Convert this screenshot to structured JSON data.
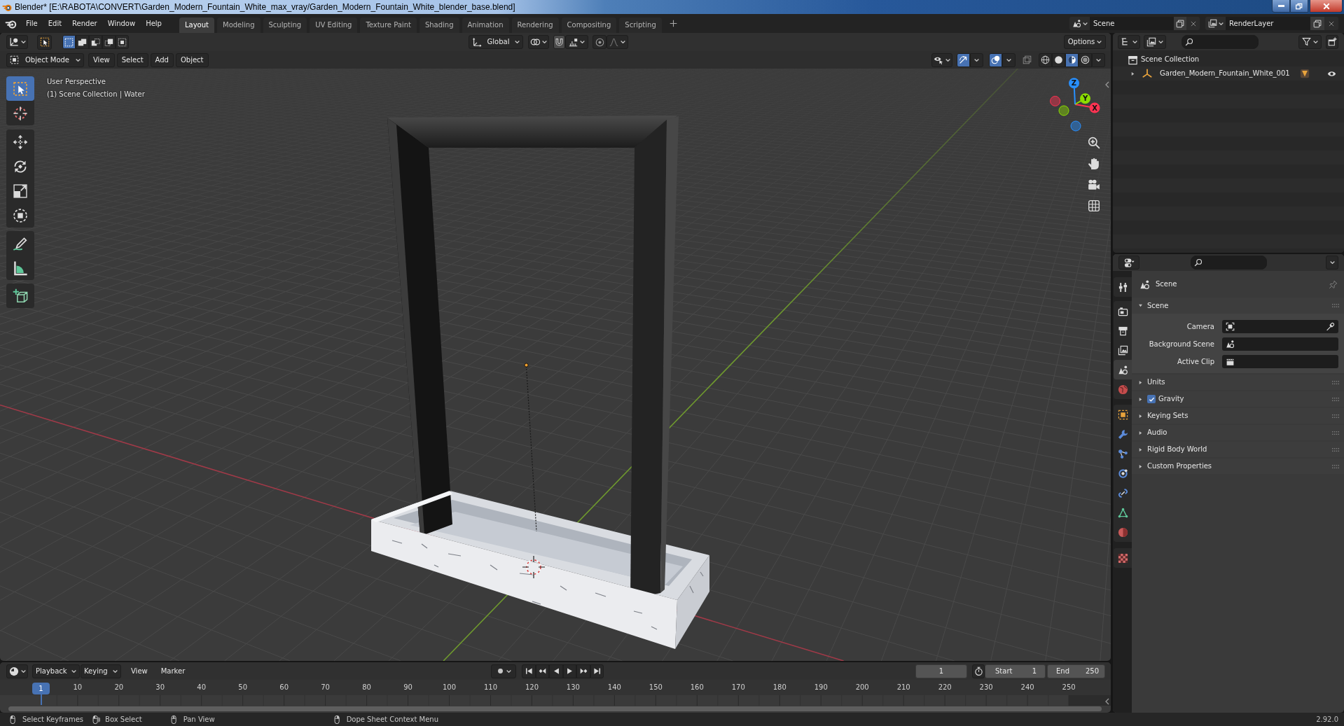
{
  "title_bar": {
    "title": "Blender* [E:\\RABOTA\\CONVERT\\Garden_Modern_Fountain_White_max_vray/Garden_Modern_Fountain_White_blender_base.blend]"
  },
  "top_bar": {
    "menus": [
      "File",
      "Edit",
      "Render",
      "Window",
      "Help"
    ],
    "workspaces": [
      {
        "label": "Layout",
        "selected": true
      },
      {
        "label": "Modeling",
        "selected": false
      },
      {
        "label": "Sculpting",
        "selected": false
      },
      {
        "label": "UV Editing",
        "selected": false
      },
      {
        "label": "Texture Paint",
        "selected": false
      },
      {
        "label": "Shading",
        "selected": false
      },
      {
        "label": "Animation",
        "selected": false
      },
      {
        "label": "Rendering",
        "selected": false
      },
      {
        "label": "Compositing",
        "selected": false
      },
      {
        "label": "Scripting",
        "selected": false
      }
    ],
    "scene": "Scene",
    "view_layer": "RenderLayer"
  },
  "tool_header": {
    "select_modes": [
      {
        "kind": "set",
        "selected": true
      },
      {
        "kind": "extend",
        "selected": false
      },
      {
        "kind": "subtract",
        "selected": false
      },
      {
        "kind": "difference",
        "selected": false
      },
      {
        "kind": "intersect",
        "selected": false
      }
    ],
    "orientation": "Global",
    "snap_on": false,
    "proportional_on": false,
    "options": "Options"
  },
  "viewport_header": {
    "mode": "Object Mode",
    "menus": [
      "View",
      "Select",
      "Add",
      "Object"
    ],
    "gizmos_on": true,
    "overlays_on": true,
    "xray_on": false,
    "shading": [
      {
        "kind": "wireframe",
        "selected": false
      },
      {
        "kind": "solid",
        "selected": false
      },
      {
        "kind": "material",
        "selected": true
      },
      {
        "kind": "rendered",
        "selected": false
      }
    ]
  },
  "viewport": {
    "tools": [
      {
        "kind": "select_box",
        "selected": true
      },
      {
        "kind": "cursor",
        "selected": false
      },
      {
        "kind": "move",
        "selected": false
      },
      {
        "kind": "rotate",
        "selected": false
      },
      {
        "kind": "scale",
        "selected": false
      },
      {
        "kind": "transform",
        "selected": false
      },
      {
        "kind": "annotate",
        "selected": false
      },
      {
        "kind": "measure",
        "selected": false
      },
      {
        "kind": "add_cube",
        "selected": false
      }
    ],
    "view_name": "User Perspective",
    "collection_info": "(1) Scene Collection | Water",
    "axes": [
      {
        "label": "X",
        "color": "#ff3352"
      },
      {
        "label": "Y",
        "color": "#8bdc00"
      },
      {
        "label": "Z",
        "color": "#2890ff"
      }
    ]
  },
  "outliner": {
    "root": "Scene Collection",
    "items": [
      {
        "label": "Garden_Modern_Fountain_White_001",
        "expanded": false,
        "visible": true
      }
    ]
  },
  "properties": {
    "tabs": [
      {
        "kind": "tool",
        "selected": false
      },
      {
        "kind": "render",
        "selected": false
      },
      {
        "kind": "output",
        "selected": false
      },
      {
        "kind": "view_layer",
        "selected": false
      },
      {
        "kind": "scene",
        "selected": true
      },
      {
        "kind": "world",
        "selected": false
      },
      {
        "kind": "object",
        "selected": false
      },
      {
        "kind": "modifiers",
        "selected": false
      },
      {
        "kind": "particles",
        "selected": false
      },
      {
        "kind": "physics",
        "selected": false
      },
      {
        "kind": "constraints",
        "selected": false
      },
      {
        "kind": "data",
        "selected": false
      },
      {
        "kind": "material",
        "selected": false
      },
      {
        "kind": "texture",
        "selected": false
      }
    ],
    "context": "Scene",
    "panels": [
      {
        "label": "Scene",
        "kind": "section",
        "expanded": true,
        "fields": [
          {
            "label": "Camera",
            "kind": "camera"
          },
          {
            "label": "Background Scene",
            "kind": "scene"
          },
          {
            "label": "Active Clip",
            "kind": "clip"
          }
        ]
      },
      {
        "label": "Units",
        "kind": "section",
        "expanded": false
      },
      {
        "label": "Gravity",
        "kind": "checkbox",
        "checked": true,
        "expanded": false
      },
      {
        "label": "Keying Sets",
        "kind": "section",
        "expanded": false
      },
      {
        "label": "Audio",
        "kind": "section",
        "expanded": false
      },
      {
        "label": "Rigid Body World",
        "kind": "section",
        "expanded": false
      },
      {
        "label": "Custom Properties",
        "kind": "section",
        "expanded": false
      }
    ]
  },
  "timeline": {
    "menus": [
      {
        "label": "Playback",
        "kind": "dropdown"
      },
      {
        "label": "Keying",
        "kind": "dropdown"
      },
      {
        "label": "View",
        "kind": "menu"
      },
      {
        "label": "Marker",
        "kind": "menu"
      }
    ],
    "auto_keying_on": false,
    "current_frame": "1",
    "start_label": "Start",
    "start": "1",
    "end_label": "End",
    "end": "250",
    "playhead": "1",
    "ruler": [
      "10",
      "20",
      "30",
      "40",
      "50",
      "60",
      "70",
      "80",
      "90",
      "100",
      "110",
      "120",
      "130",
      "140",
      "150",
      "160",
      "170",
      "180",
      "190",
      "200",
      "210",
      "220",
      "230",
      "240",
      "250"
    ]
  },
  "status_bar": {
    "hints": [
      {
        "kind": "left",
        "text": "Select Keyframes"
      },
      {
        "kind": "drag",
        "text": "Box Select"
      },
      {
        "kind": "middle",
        "text": "Pan View"
      },
      {
        "kind": "right",
        "text": "Dope Sheet Context Menu"
      }
    ],
    "version": "2.92.0"
  }
}
